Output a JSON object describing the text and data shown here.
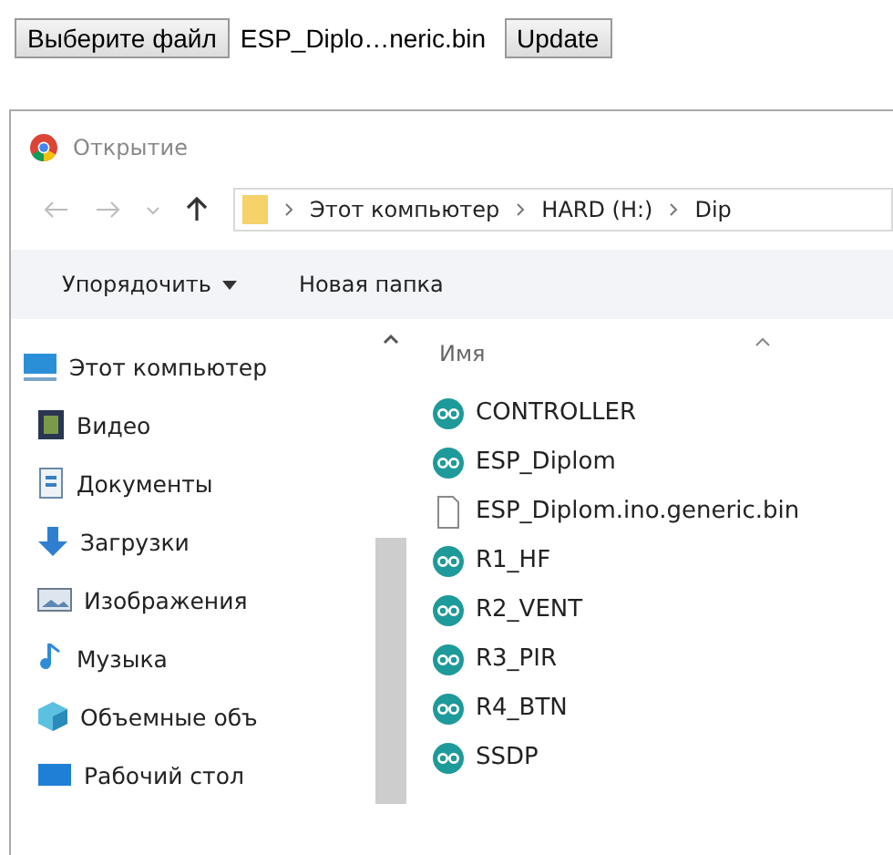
{
  "upload_form": {
    "choose_button": "Выберите файл",
    "file_name": "ESP_Diplo…neric.bin",
    "update_button": "Update"
  },
  "dialog": {
    "title": "Открытие",
    "breadcrumbs": [
      "Этот компьютер",
      "HARD (H:)",
      "Dip"
    ],
    "toolbar": {
      "organize": "Упорядочить",
      "new_folder": "Новая папка"
    },
    "sidebar": {
      "items": [
        {
          "label": "Этот компьютер",
          "kind": "computer"
        },
        {
          "label": "Видео",
          "kind": "video"
        },
        {
          "label": "Документы",
          "kind": "documents"
        },
        {
          "label": "Загрузки",
          "kind": "downloads"
        },
        {
          "label": "Изображения",
          "kind": "pictures"
        },
        {
          "label": "Музыка",
          "kind": "music"
        },
        {
          "label": "Объемные объ",
          "kind": "objects"
        },
        {
          "label": "Рабочий стол",
          "kind": "desktop"
        }
      ]
    },
    "list": {
      "column": "Имя",
      "files": [
        {
          "name": "CONTROLLER",
          "kind": "sketch"
        },
        {
          "name": "ESP_Diplom",
          "kind": "sketch"
        },
        {
          "name": "ESP_Diplom.ino.generic.bin",
          "kind": "file"
        },
        {
          "name": "R1_HF",
          "kind": "sketch"
        },
        {
          "name": "R2_VENT",
          "kind": "sketch"
        },
        {
          "name": "R3_PIR",
          "kind": "sketch"
        },
        {
          "name": "R4_BTN",
          "kind": "sketch"
        },
        {
          "name": "SSDP",
          "kind": "sketch"
        }
      ]
    }
  }
}
